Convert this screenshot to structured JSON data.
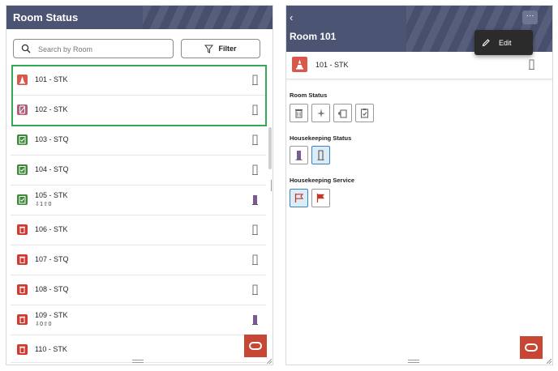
{
  "colors": {
    "header_bg": "#4c5473",
    "accent_red": "#c74634",
    "highlight_green": "#34a853",
    "selected_blue": "#dcecf7"
  },
  "left": {
    "title": "Room Status",
    "search": {
      "placeholder": "Search by Room",
      "value": ""
    },
    "filter_label": "Filter",
    "rooms": [
      {
        "name": "101 - STK",
        "sub": "",
        "icon": "cone-icon",
        "icon_color": "#d9584c",
        "status": "vacant"
      },
      {
        "name": "102 - STK",
        "sub": "",
        "icon": "do-not-disturb-icon",
        "icon_color": "#b15e7c",
        "status": "vacant"
      },
      {
        "name": "103 - STQ",
        "sub": "",
        "icon": "clipboard-check-icon",
        "icon_color": "#3f8a3a",
        "status": "vacant"
      },
      {
        "name": "104 - STQ",
        "sub": "",
        "icon": "clipboard-check-icon",
        "icon_color": "#3f8a3a",
        "status": "vacant"
      },
      {
        "name": "105 - STK",
        "sub": "⇩1⇧0",
        "icon": "clipboard-check-icon",
        "icon_color": "#3f8a3a",
        "status": "occupied"
      },
      {
        "name": "106 - STK",
        "sub": "",
        "icon": "trash-icon",
        "icon_color": "#d13b2f",
        "status": "vacant"
      },
      {
        "name": "107 - STQ",
        "sub": "",
        "icon": "trash-icon",
        "icon_color": "#d13b2f",
        "status": "vacant"
      },
      {
        "name": "108 - STQ",
        "sub": "",
        "icon": "trash-icon",
        "icon_color": "#d13b2f",
        "status": "vacant"
      },
      {
        "name": "109 - STK",
        "sub": "⇩0⇧0",
        "icon": "trash-icon",
        "icon_color": "#d13b2f",
        "status": "occupied"
      },
      {
        "name": "110 - STK",
        "sub": "",
        "icon": "trash-icon",
        "icon_color": "#d13b2f",
        "status": "vacant"
      }
    ]
  },
  "right": {
    "back_glyph": "‹",
    "title": "Room 101",
    "more_glyph": "···",
    "menu": {
      "edit_label": "Edit"
    },
    "room": {
      "name": "101 - STK",
      "icon": "cone-icon"
    },
    "room_status_label": "Room Status",
    "housekeeping_status_label": "Housekeeping Status",
    "housekeeping_service_label": "Housekeeping Service",
    "room_status_options": [
      "dirty-trash-icon",
      "clean-sparkle-icon",
      "pickup-icon",
      "inspected-icon"
    ],
    "housekeeping_status_options": [
      {
        "icon": "occupied-door-icon",
        "selected": false
      },
      {
        "icon": "vacant-door-icon",
        "selected": true
      }
    ],
    "housekeeping_service_options": [
      {
        "icon": "flag-outline-icon",
        "selected": true
      },
      {
        "icon": "flag-filled-icon",
        "selected": false
      }
    ]
  }
}
